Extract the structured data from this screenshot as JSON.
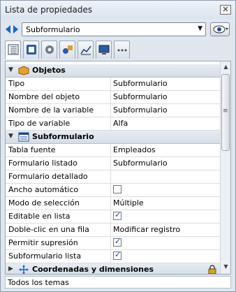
{
  "window": {
    "title": "Lista de propiedades",
    "close_glyph": "✕"
  },
  "selector": {
    "value": "Subformulario",
    "arrow_glyph": "▼"
  },
  "tabs": [
    {
      "icon": "property-list-icon"
    },
    {
      "icon": "form-icon"
    },
    {
      "icon": "gear-icon"
    },
    {
      "icon": "objects-icon"
    },
    {
      "icon": "chart-icon"
    },
    {
      "icon": "monitor-icon"
    },
    {
      "icon": "more-icon"
    }
  ],
  "sections": {
    "objetos": {
      "title": "Objetos",
      "toggle": "▼"
    },
    "subformulario": {
      "title": "Subformulario",
      "toggle": "▼"
    },
    "coordenadas": {
      "title": "Coordenadas y dimensiones",
      "toggle": "▶"
    }
  },
  "objetos_rows": [
    {
      "name": "Tipo",
      "value": "Subformulario"
    },
    {
      "name": "Nombre del objeto",
      "value": "Subformulario"
    },
    {
      "name": "Nombre de la variable",
      "value": "Subformulario"
    },
    {
      "name": "Tipo de variable",
      "value": "Alfa"
    }
  ],
  "subform_rows": [
    {
      "name": "Tabla fuente",
      "value": "Empleados"
    },
    {
      "name": "Formulario listado",
      "value": "Subformulario"
    },
    {
      "name": "Formulario detallado",
      "value": ""
    },
    {
      "name": "Ancho automático",
      "checked": false
    },
    {
      "name": "Modo de selección",
      "value": "Múltiple"
    },
    {
      "name": "Editable en lista",
      "checked": true
    },
    {
      "name": "Doble-clic en una fila",
      "value": "Modificar registro"
    },
    {
      "name": "Permitir supresión",
      "checked": true
    },
    {
      "name": "Subformulario lista",
      "checked": true
    }
  ],
  "scrollbar": {
    "up": "▲",
    "down": "▼"
  },
  "status": {
    "text": "Todos los temas"
  },
  "colors": {
    "section_bg": "#dbe3ec",
    "border": "#9aa6b5",
    "check": "#1f3f8a"
  }
}
